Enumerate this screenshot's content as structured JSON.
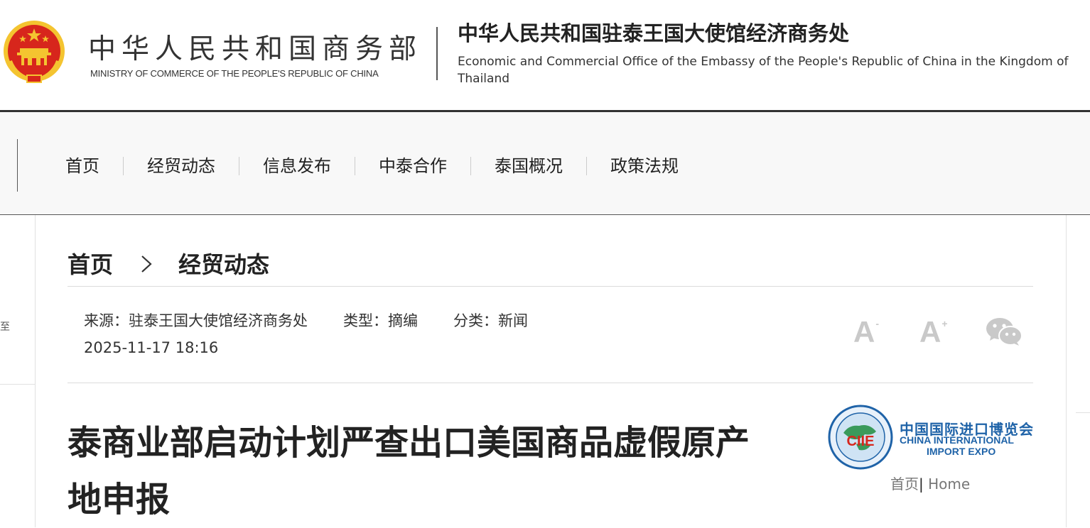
{
  "header": {
    "ministry_cn": "中华人民共和国商务部",
    "ministry_en": "MINISTRY OF COMMERCE OF THE PEOPLE'S REPUBLIC OF CHINA",
    "office_cn": "中华人民共和国驻泰王国大使馆经济商务处",
    "office_en": "Economic and Commercial Office of the Embassy of the People's Republic of China in the Kingdom of Thailand"
  },
  "nav": {
    "items": [
      {
        "label": "首页"
      },
      {
        "label": "经贸动态"
      },
      {
        "label": "信息发布"
      },
      {
        "label": "中泰合作"
      },
      {
        "label": "泰国概况"
      },
      {
        "label": "政策法规"
      }
    ]
  },
  "breadcrumb": {
    "home": "首页",
    "separator": ">",
    "current": "经贸动态"
  },
  "meta": {
    "source": "来源：驻泰王国大使馆经济商务处",
    "type": "类型：摘编",
    "category": "分类：新闻",
    "datetime": "2025-11-17 18:16"
  },
  "tools": {
    "font_decrease": "A",
    "font_decrease_mark": "-",
    "font_increase": "A",
    "font_increase_mark": "+",
    "share_icon": "wechat-icon"
  },
  "article": {
    "title": "泰商业部启动计划严查出口美国商品虚假原产地申报"
  },
  "sidebar": {
    "ciie_name_cn": "中国国际进口博览会",
    "ciie_name_en_1": "CHINA INTERNATIONAL",
    "ciie_name_en_2": "IMPORT EXPO",
    "ciie_badge": "CIIE",
    "link_home_cn": "首页",
    "link_divider": "|",
    "link_home_en": " Home"
  },
  "left_stub": {
    "char": "至"
  },
  "colors": {
    "emblem_red": "#d7261c",
    "emblem_gold": "#f4c430",
    "ciie_blue": "#1f63a8",
    "tool_gray": "#c9c9c9"
  }
}
